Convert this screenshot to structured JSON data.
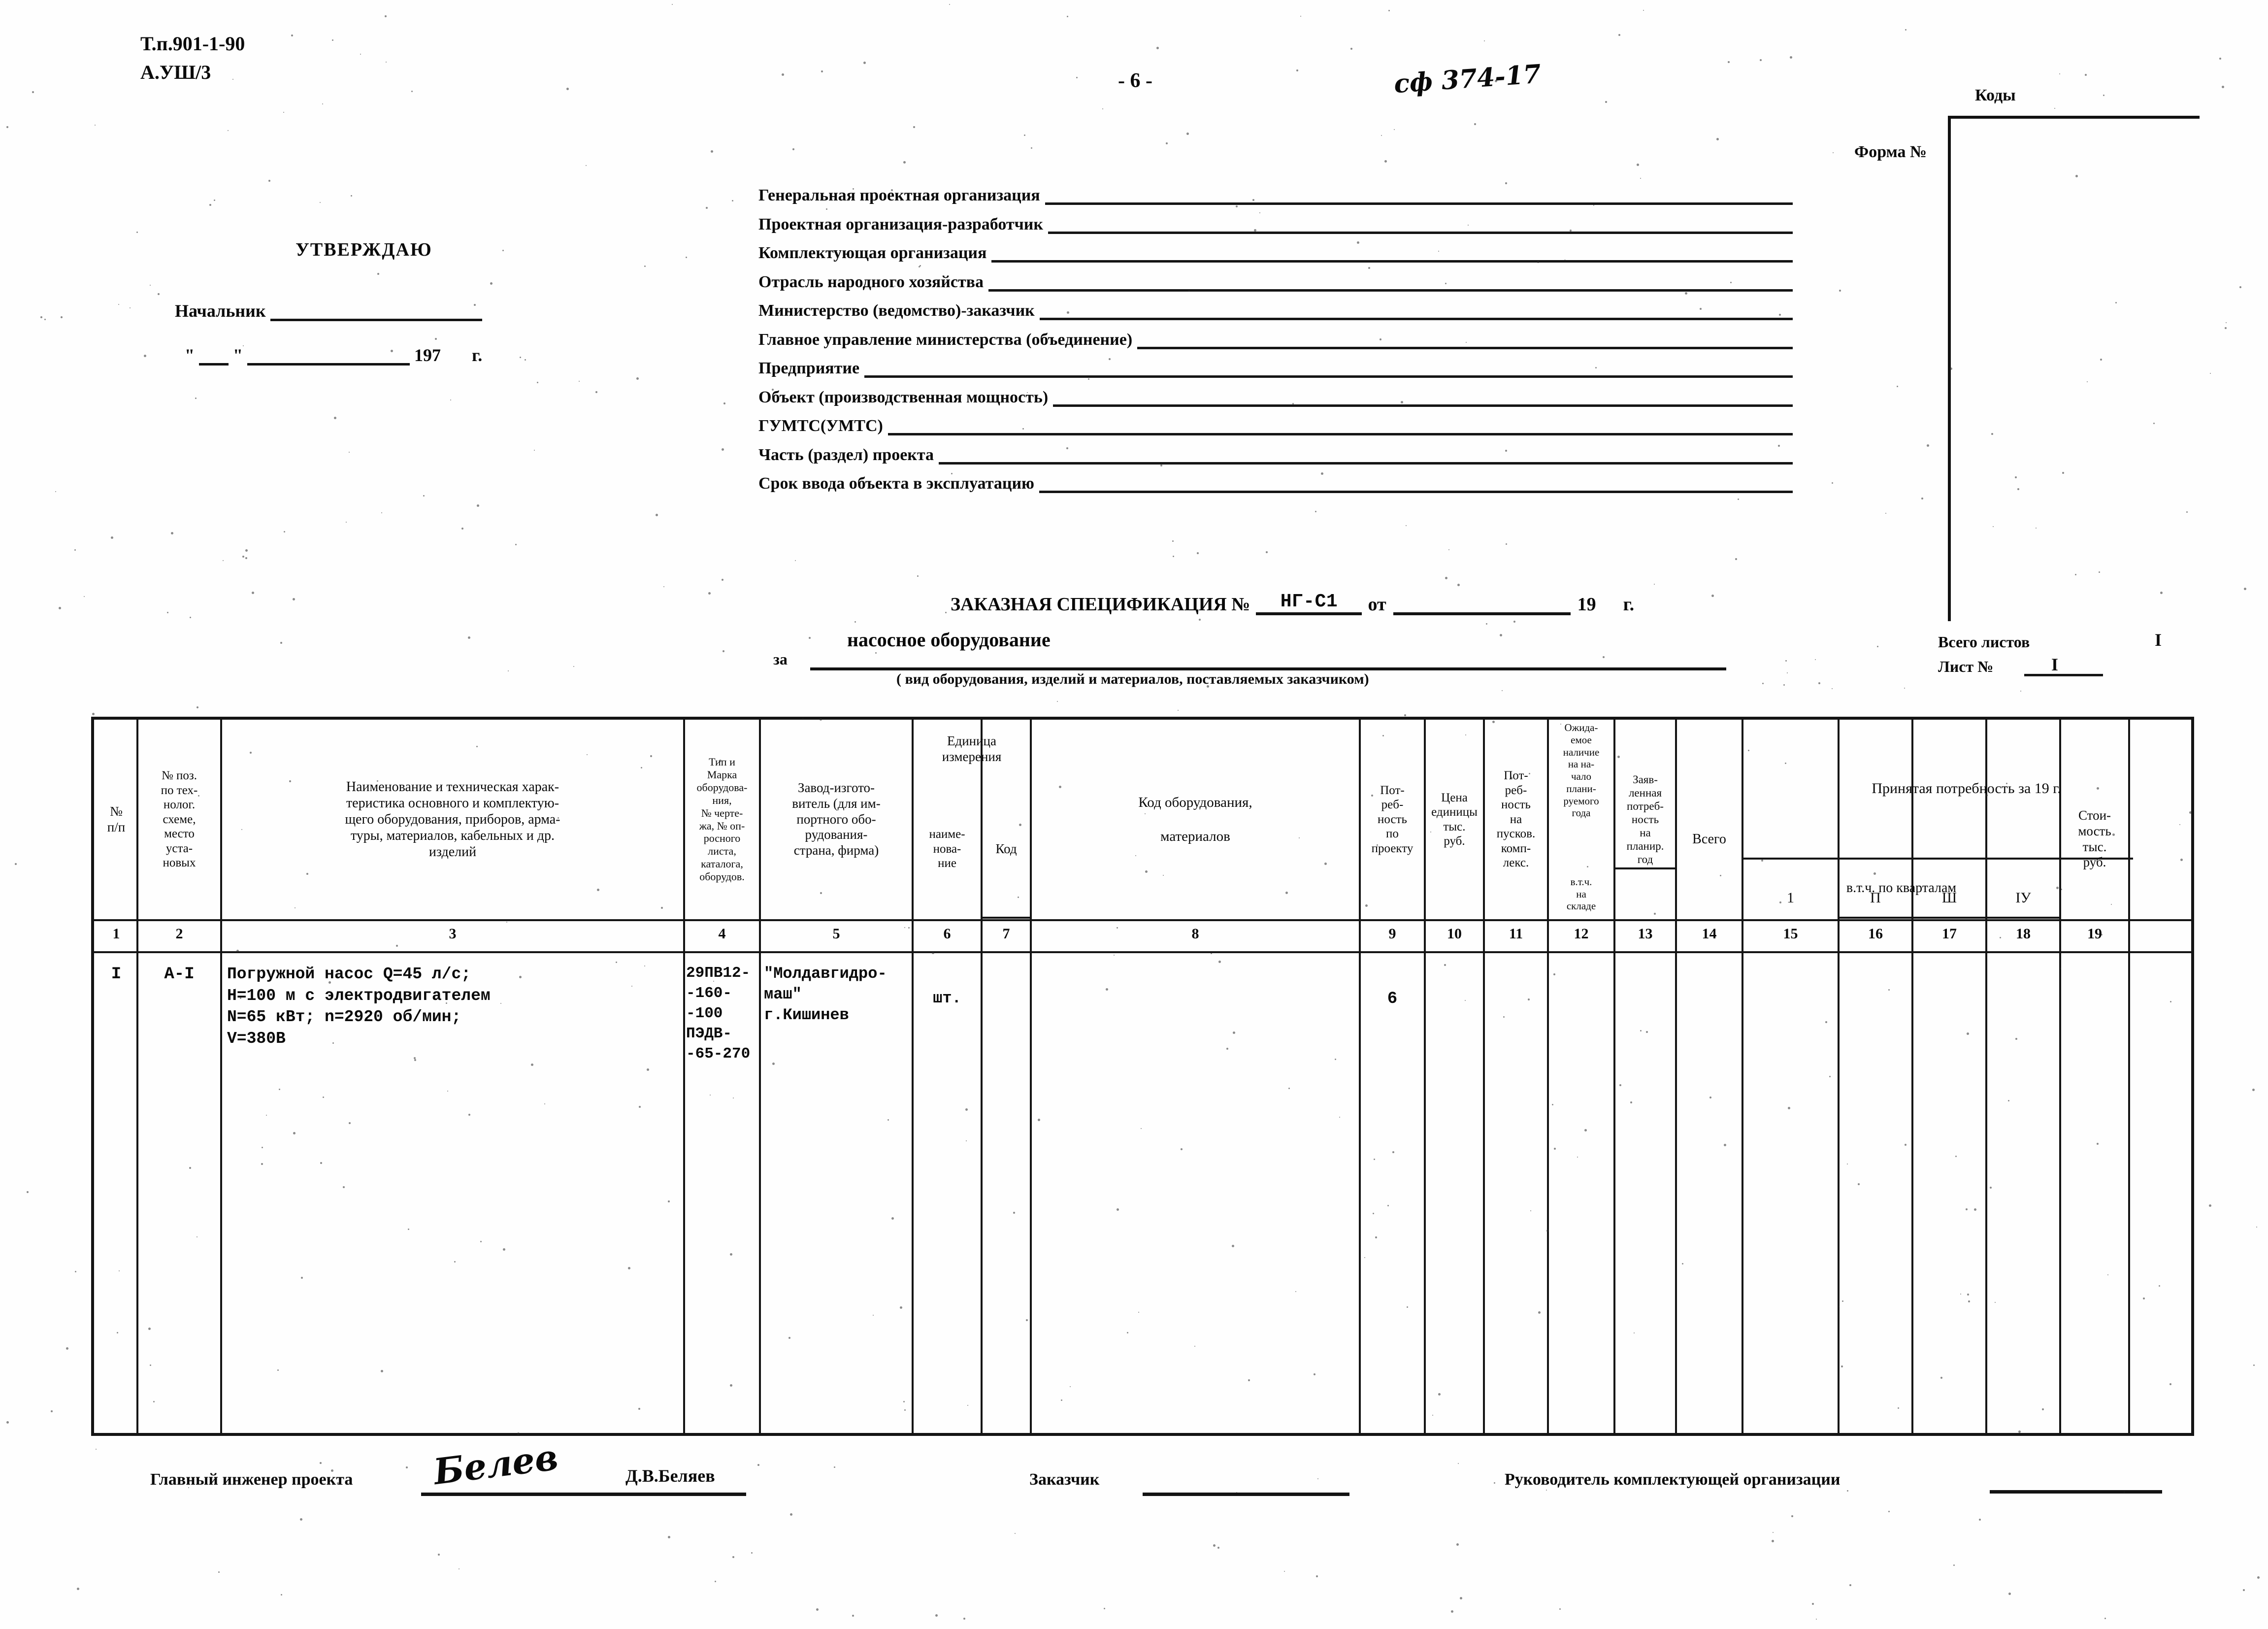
{
  "header": {
    "doc_code_line1": "Т.п.901-1-90",
    "doc_code_line2": "А.УШ/3",
    "page_number": "- 6 -",
    "hand_note": "сф 374-17",
    "form_label": "Форма №",
    "codes_label": "Коды"
  },
  "approval": {
    "title": "УТВЕРЖДАЮ",
    "chief_label": "Начальник",
    "date_prefix": "\"",
    "date_sep": "\"",
    "year_label": "197",
    "year_suffix": "г."
  },
  "fields": [
    {
      "label": "Генеральная проектная организация",
      "value": ""
    },
    {
      "label": "Проектная организация-разработчик",
      "value": ""
    },
    {
      "label": "Комплектующая организация",
      "value": ""
    },
    {
      "label": "Отрасль народного хозяйства",
      "value": ""
    },
    {
      "label": "Министерство (ведомство)-заказчик",
      "value": ""
    },
    {
      "label": "Главное управление министерства (объединение)",
      "value": ""
    },
    {
      "label": "Предприятие",
      "value": ""
    },
    {
      "label": "Объект (производственная мощность)",
      "value": ""
    },
    {
      "label": "ГУМТС(УМТС)",
      "value": ""
    },
    {
      "label": "Часть (раздел) проекта",
      "value": ""
    },
    {
      "label": "Срок ввода объекта в эксплуатацию",
      "value": ""
    }
  ],
  "spec": {
    "title": "ЗАКАЗНАЯ СПЕЦИФИКАЦИЯ №",
    "number": "НГ-С1",
    "from_label": "от",
    "year_prefix": "19",
    "year_suffix": "г.",
    "za_label": "за",
    "subject": "насосное оборудование",
    "caption": "( вид оборудования, изделий и материалов, поставляемых заказчиком)",
    "sheets_total_label": "Всего листов",
    "sheets_total_value": "I",
    "sheet_no_label": "Лист №",
    "sheet_no_value": "I"
  },
  "table": {
    "headers": {
      "col1": "№\nп/п",
      "col2": "№ поз.\nпо тех-\nнолог.\nсхеме,\nместо\nуста-\nновых",
      "col3": "Наименование и техническая харак-\nтеристика основного и комплектую-\nщего оборудования, приборов, арма-\nтуры, материалов, кабельных и др.\nизделий",
      "col4": "Тип и\nМарка\nоборудова-\nния,\n№ черте-\nжа, № оп-\nросного\nлиста,\nкаталога,\nоборудов.",
      "col5": "Завод-изгото-\nвитель (для им-\nпортного обо-\nрудования-\nстрана, фирма)",
      "group_unit": "Единица\nизмерения",
      "col6": "наиме-\nнова-\nние",
      "col7": "Код",
      "col8": "Код оборудования,\n\nматериалов",
      "col9": "Пот-\nреб-\nность\nпо\nпроекту",
      "col10": "Цена\nединицы\nтыс.\nруб.",
      "col11": "Пот-\nреб-\nность\nна\nпусков.\nкомп-\nлекс.",
      "col12": "Ожида-\nемое\nналичие\nна на-\nчало\nплани-\nруемого\nгода",
      "col12b": "в.т.ч.\nна\nскладе",
      "col13": "Заяв-\nленная\nпотреб-\nность\nна\nпланир.\nгод",
      "group_accepted": "Принятая потребность за 19        г.",
      "col14": "Всего",
      "group_quarters": "в.т.ч. по кварталам",
      "col15": "1",
      "col16": "П",
      "col17": "Ш",
      "col18": "IУ",
      "col19": "Стои-\nмость\nтыс.\nруб."
    },
    "column_numbers": [
      "1",
      "2",
      "3",
      "4",
      "5",
      "6",
      "7",
      "8",
      "9",
      "10",
      "11",
      "12",
      "13",
      "14",
      "15",
      "16",
      "17",
      "18",
      "19"
    ],
    "rows": [
      {
        "c1": "I",
        "c2": "А-I",
        "c3": "Погружной насос Q=45 л/с;\nH=100 м с электродвигателем\nN=65 кВт;   n=2920 об/мин;\nV=380В",
        "c4": "29ПВ12-\n-160-\n-100\nПЭДВ-\n-65-270",
        "c5": "\"Молдавгидро-\nмаш\"\nг.Кишинев",
        "c6": "шт.",
        "c7": "",
        "c8": "",
        "c9": "6",
        "c10": "",
        "c11": "",
        "c12": "",
        "c13": "",
        "c14": "",
        "c15": "",
        "c16": "",
        "c17": "",
        "c18": "",
        "c19": ""
      }
    ]
  },
  "footer": {
    "gip_label": "Главный инженер проекта",
    "gip_signature": "Белев",
    "gip_name": "Д.В.Беляев",
    "customer_label": "Заказчик",
    "head_label": "Руководитель комплектующей организации"
  }
}
